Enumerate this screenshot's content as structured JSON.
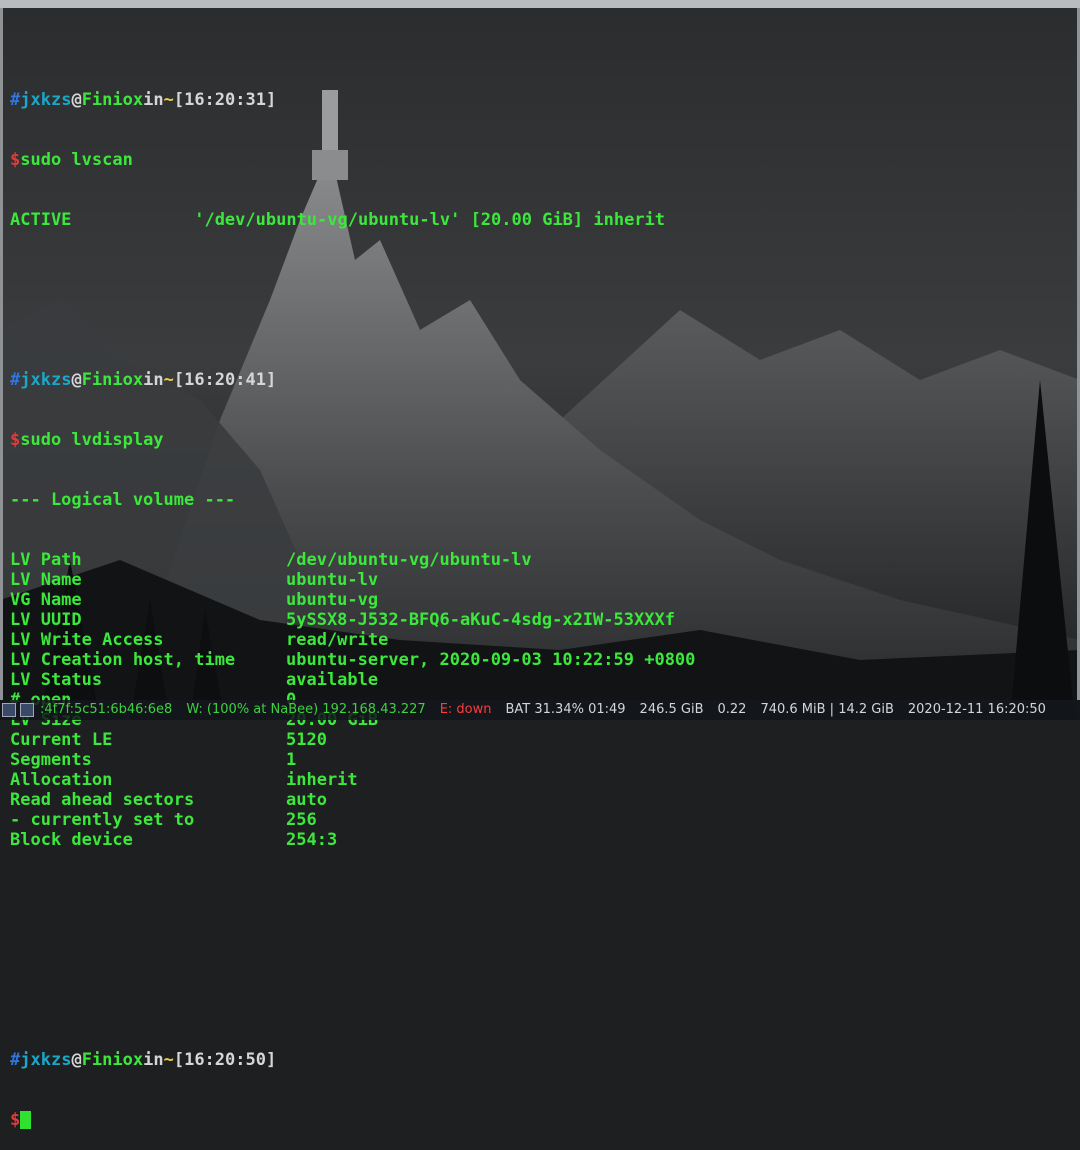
{
  "prompt": {
    "user": "jxkzs",
    "at": "@",
    "host": "Finiox",
    "in": "in",
    "dir": "~",
    "hash": "#",
    "dollar": "$"
  },
  "blocks": [
    {
      "time": "[16:20:31]",
      "command": "sudo lvscan",
      "output": [
        "ACTIVE            '/dev/ubuntu-vg/ubuntu-lv' [20.00 GiB] inherit"
      ]
    },
    {
      "time": "[16:20:41]",
      "command": "sudo lvdisplay",
      "header": "--- Logical volume ---",
      "fields": [
        {
          "k": "LV Path",
          "v": "/dev/ubuntu-vg/ubuntu-lv"
        },
        {
          "k": "LV Name",
          "v": "ubuntu-lv"
        },
        {
          "k": "VG Name",
          "v": "ubuntu-vg"
        },
        {
          "k": "LV UUID",
          "v": "5ySSX8-J532-BFQ6-aKuC-4sdg-x2IW-53XXXf"
        },
        {
          "k": "LV Write Access",
          "v": "read/write"
        },
        {
          "k": "LV Creation host, time",
          "v": "ubuntu-server, 2020-09-03 10:22:59 +0800"
        },
        {
          "k": "LV Status",
          "v": "available"
        },
        {
          "k": "# open",
          "v": "0"
        },
        {
          "k": "LV Size",
          "v": "20.00 GiB"
        },
        {
          "k": "Current LE",
          "v": "5120"
        },
        {
          "k": "Segments",
          "v": "1"
        },
        {
          "k": "Allocation",
          "v": "inherit"
        },
        {
          "k": "Read ahead sectors",
          "v": "auto"
        },
        {
          "k": "- currently set to",
          "v": "256"
        },
        {
          "k": "Block device",
          "v": "254:3"
        }
      ]
    },
    {
      "time": "[16:20:50]",
      "command": ""
    }
  ],
  "statusbar": {
    "ipv6": ":4f7f:5c51:6b46:6e8",
    "wifi": "W: (100% at NaBee) 192.168.43.227",
    "ethernet": "E: down",
    "battery": "BAT 31.34% 01:49",
    "disk": "246.5 GiB",
    "load": "0.22",
    "memory": "740.6 MiB | 14.2 GiB",
    "datetime": "2020-12-11 16:20:50"
  },
  "colors": {
    "green": "#3be83b",
    "blue": "#2f77e0",
    "red": "#e23b3b",
    "cyan": "#1aa8c8",
    "yellow": "#f0d040"
  }
}
